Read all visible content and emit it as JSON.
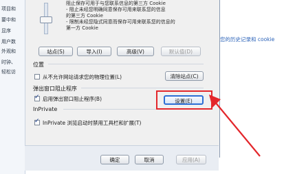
{
  "background_left": {
    "items": [
      "项目和",
      "要中和",
      "显序",
      "用户数",
      "外观和",
      "时钟、",
      "轻松访"
    ]
  },
  "privacy": {
    "top_text_lines": [
      "阻止保存可用于与您联系信息的第三方 Cookie",
      "- 阻止未经您明确同意保存可用来联系您的信息",
      "  的第三方 Cookie",
      "- 限制未经您隐式同意而保存可用来联系您的信息的",
      "  第一方 Cookie"
    ],
    "buttons": {
      "sites": "站点(S)",
      "import": "导入(I)",
      "advanced": "高级(V)",
      "default": "默认值(D)"
    }
  },
  "location": {
    "title": "位置",
    "never_allow_label": "从不允许网站请求您的物理位置(L)",
    "never_allow_checked": false,
    "clear_sites_button": "清除站点(C)"
  },
  "popup_blocker": {
    "title": "弹出窗口阻止程序",
    "enable_label": "启用弹出窗口阻止程序(B)",
    "enable_checked": true,
    "settings_button": "设置(E)"
  },
  "inprivate": {
    "title": "InPrivate",
    "disable_toolbars_label": "InPrivate 浏览启动时禁用工具栏和扩展(T)",
    "disable_toolbars_checked": true
  },
  "footer": {
    "ok": "确定",
    "cancel": "取消",
    "apply": "应用(A)"
  },
  "right_link": "您的历史记录和 cookie",
  "colors": {
    "callout": "#e3262b",
    "arrow": "#e3262b",
    "highlight_border": "#2c6ed5"
  }
}
